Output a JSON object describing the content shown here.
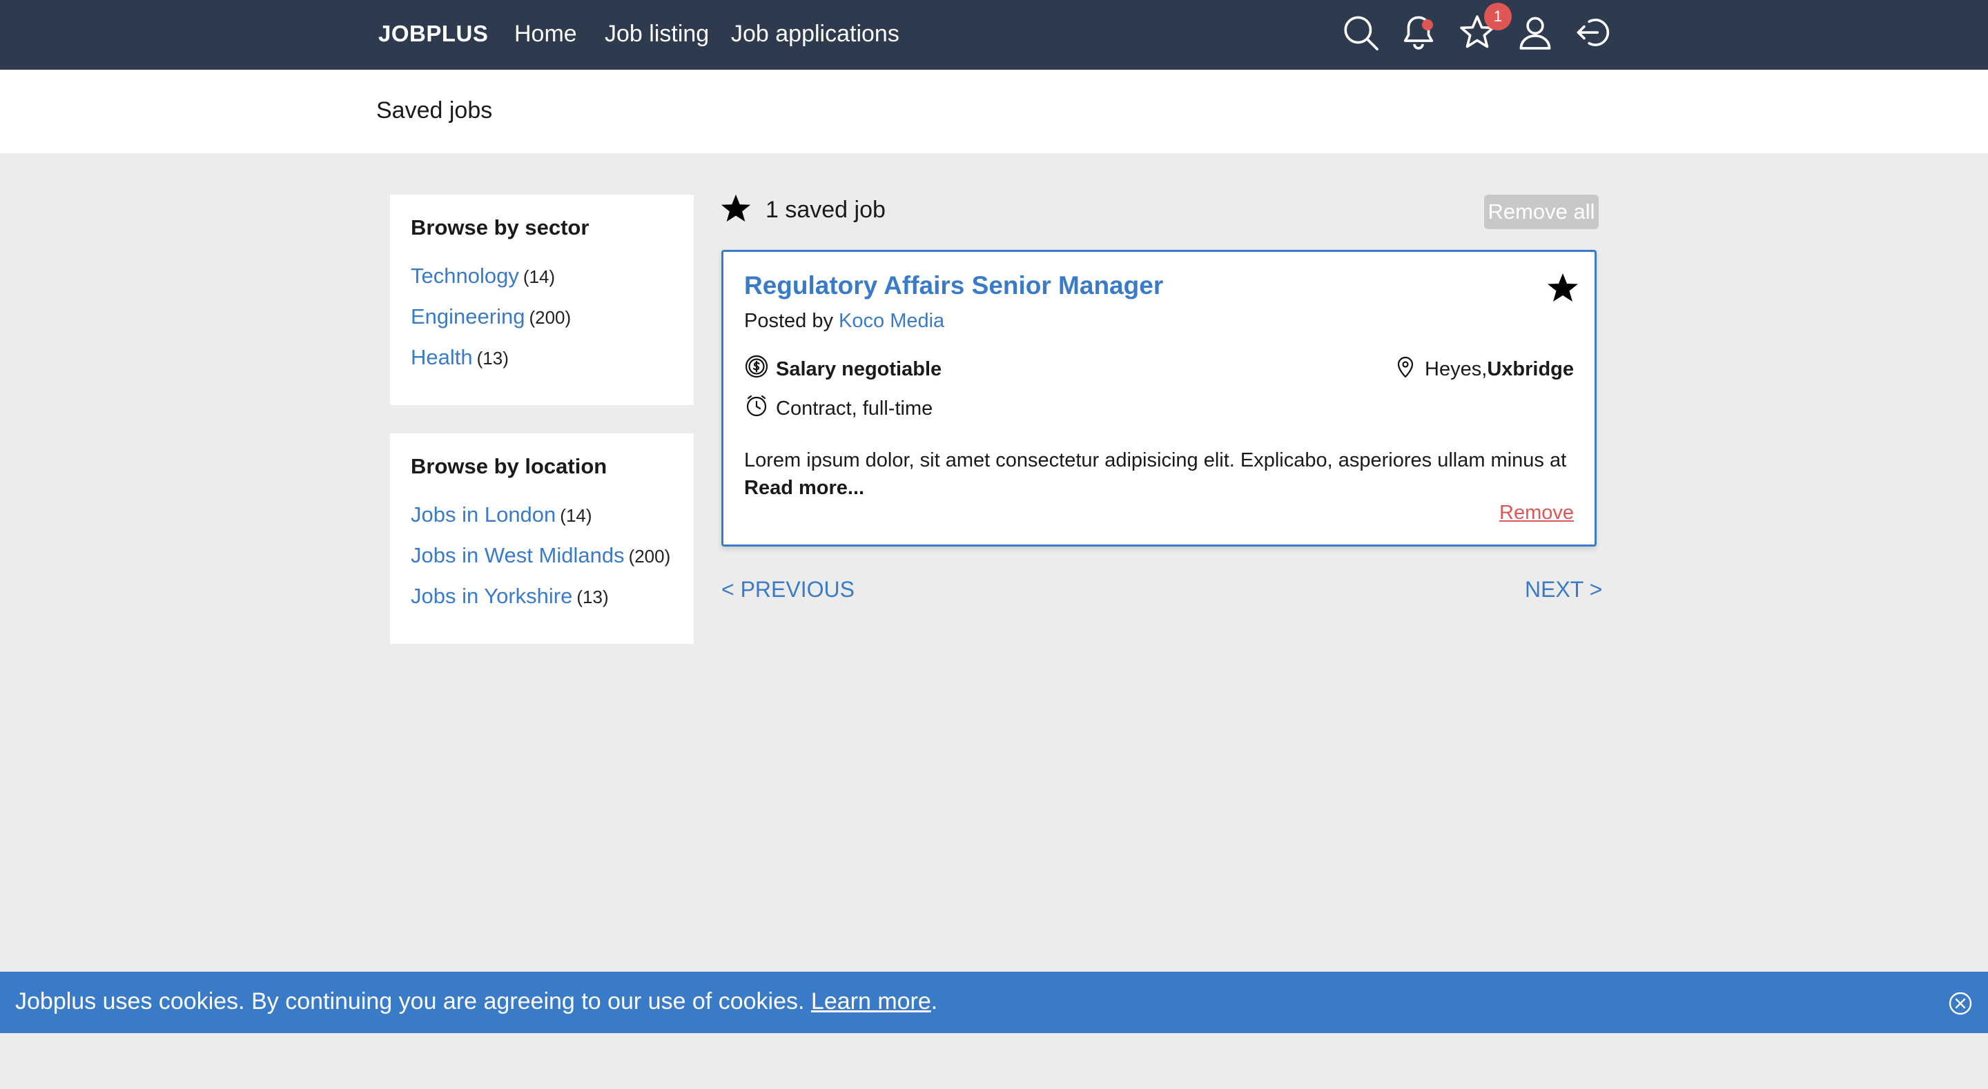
{
  "colors": {
    "navbar_bg": "#2e3a4e",
    "accent": "#3a7bc8",
    "danger": "#e05555",
    "page_bg": "#ececec"
  },
  "navbar": {
    "brand": "JOBPLUS",
    "links": [
      "Home",
      "Job listing",
      "Job applications"
    ],
    "icons": [
      "search-icon",
      "bell-icon",
      "star-icon",
      "user-icon",
      "logout-icon"
    ],
    "saved_badge": "1"
  },
  "subheader": {
    "title": "Saved jobs"
  },
  "sidebar": {
    "sector": {
      "title": "Browse by sector",
      "items": [
        {
          "label": "Technology",
          "count": "(14)"
        },
        {
          "label": "Engineering",
          "count": "(200)"
        },
        {
          "label": "Health",
          "count": "(13)"
        }
      ]
    },
    "location": {
      "title": "Browse by location",
      "items": [
        {
          "label": "Jobs in London",
          "count": "(14)"
        },
        {
          "label": "Jobs in West Midlands",
          "count": "(200)"
        },
        {
          "label": "Jobs in Yorkshire",
          "count": "(13)"
        }
      ]
    }
  },
  "main": {
    "saved_count_label": "1 saved job",
    "remove_all_label": "Remove all",
    "job": {
      "title": "Regulatory Affairs Senior Manager",
      "posted_by_prefix": "Posted by ",
      "company": "Koco Media",
      "salary": "Salary negotiable",
      "location_area": "Heyes,",
      "location_city": "Uxbridge",
      "contract": "Contract, full-time",
      "description": "Lorem ipsum dolor, sit amet consectetur adipisicing elit. Explicabo, asperiores ullam minus at ",
      "read_more": "Read more...",
      "remove_label": "Remove"
    },
    "pagination": {
      "previous": "< PREVIOUS",
      "next": "NEXT >"
    }
  },
  "cookie_bar": {
    "text": "Jobplus uses cookies. By continuing you are agreeing to our use of cookies. ",
    "link": "Learn more",
    "suffix": "."
  }
}
